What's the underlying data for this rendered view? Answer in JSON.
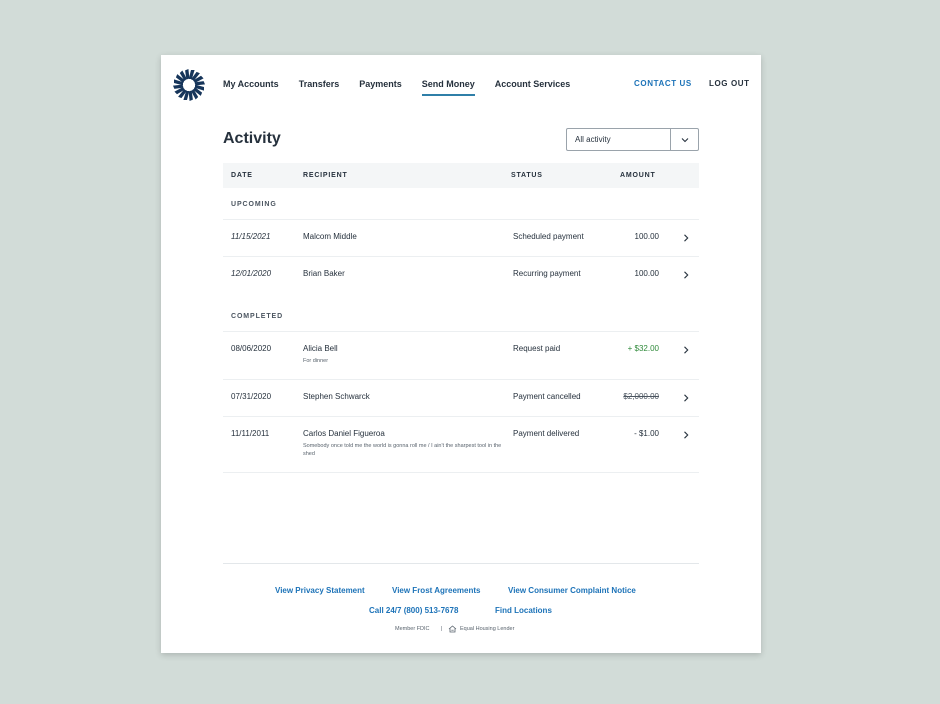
{
  "nav": {
    "items": [
      "My Accounts",
      "Transfers",
      "Payments",
      "Send Money",
      "Account Services"
    ],
    "active": "Send Money",
    "contact": "CONTACT US",
    "logout": "LOG OUT"
  },
  "page": {
    "title": "Activity",
    "filter": {
      "selected": "All activity"
    }
  },
  "table": {
    "headers": {
      "date": "DATE",
      "recipient": "RECIPIENT",
      "status": "STATUS",
      "amount": "AMOUNT"
    },
    "sections": [
      {
        "label": "UPCOMING",
        "rows": [
          {
            "date": "11/15/2021",
            "recipient": "Malcom Middle",
            "memo": "",
            "status": "Scheduled payment",
            "amount": "100.00"
          },
          {
            "date": "12/01/2020",
            "recipient": "Brian Baker",
            "memo": "",
            "status": "Recurring payment",
            "amount": "100.00"
          }
        ]
      },
      {
        "label": "COMPLETED",
        "rows": [
          {
            "date": "08/06/2020",
            "recipient": "Alicia Bell",
            "memo": "For dinner",
            "status": "Request paid",
            "amount": "+ $32.00"
          },
          {
            "date": "07/31/2020",
            "recipient": "Stephen Schwarck",
            "memo": "",
            "status": "Payment cancelled",
            "amount": "$2,000.00"
          },
          {
            "date": "11/11/2011",
            "recipient": "Carlos Daniel Figueroa",
            "memo": "Somebody once told me the world is gonna roll me / I ain't the sharpest tool in the shed",
            "status": "Payment delivered",
            "amount": "- $1.00"
          }
        ]
      }
    ]
  },
  "footer": {
    "links_row1": [
      "View Privacy Statement",
      "View Frost Agreements",
      "View Consumer Complaint Notice"
    ],
    "links_row2": [
      "Call 24/7 (800) 513-7678",
      "Find Locations"
    ],
    "member": "Member FDIC",
    "separator": "|",
    "lender": "Equal Housing Lender"
  },
  "colors": {
    "brand": "#16355a",
    "link": "#1d73b8",
    "positive": "#2f8a3a",
    "accent_underline": "#2f7fa8"
  },
  "icons": {
    "logo": "starburst-logo-icon",
    "dropdown": "chevron-down-icon",
    "row": "chevron-right-icon",
    "house": "house-icon"
  }
}
